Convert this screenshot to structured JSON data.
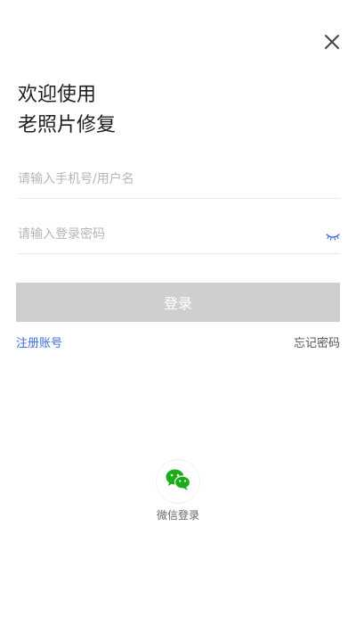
{
  "header": {
    "close_icon": "close-icon",
    "title_line1": "欢迎使用",
    "title_line2": "老照片修复"
  },
  "form": {
    "phone_placeholder": "请输入手机号/用户名",
    "phone_value": "",
    "password_placeholder": "请输入登录密码",
    "password_value": "",
    "eye_icon": "eye-closed-icon",
    "login_label": "登录"
  },
  "links": {
    "register": "注册账号",
    "forgot": "忘记密码"
  },
  "social": {
    "wechat_icon": "wechat-icon",
    "wechat_label": "微信登录"
  },
  "colors": {
    "accent": "#3d6ee0",
    "login_button_bg": "#cfcfcf",
    "wechat_green": "#1aad19"
  }
}
